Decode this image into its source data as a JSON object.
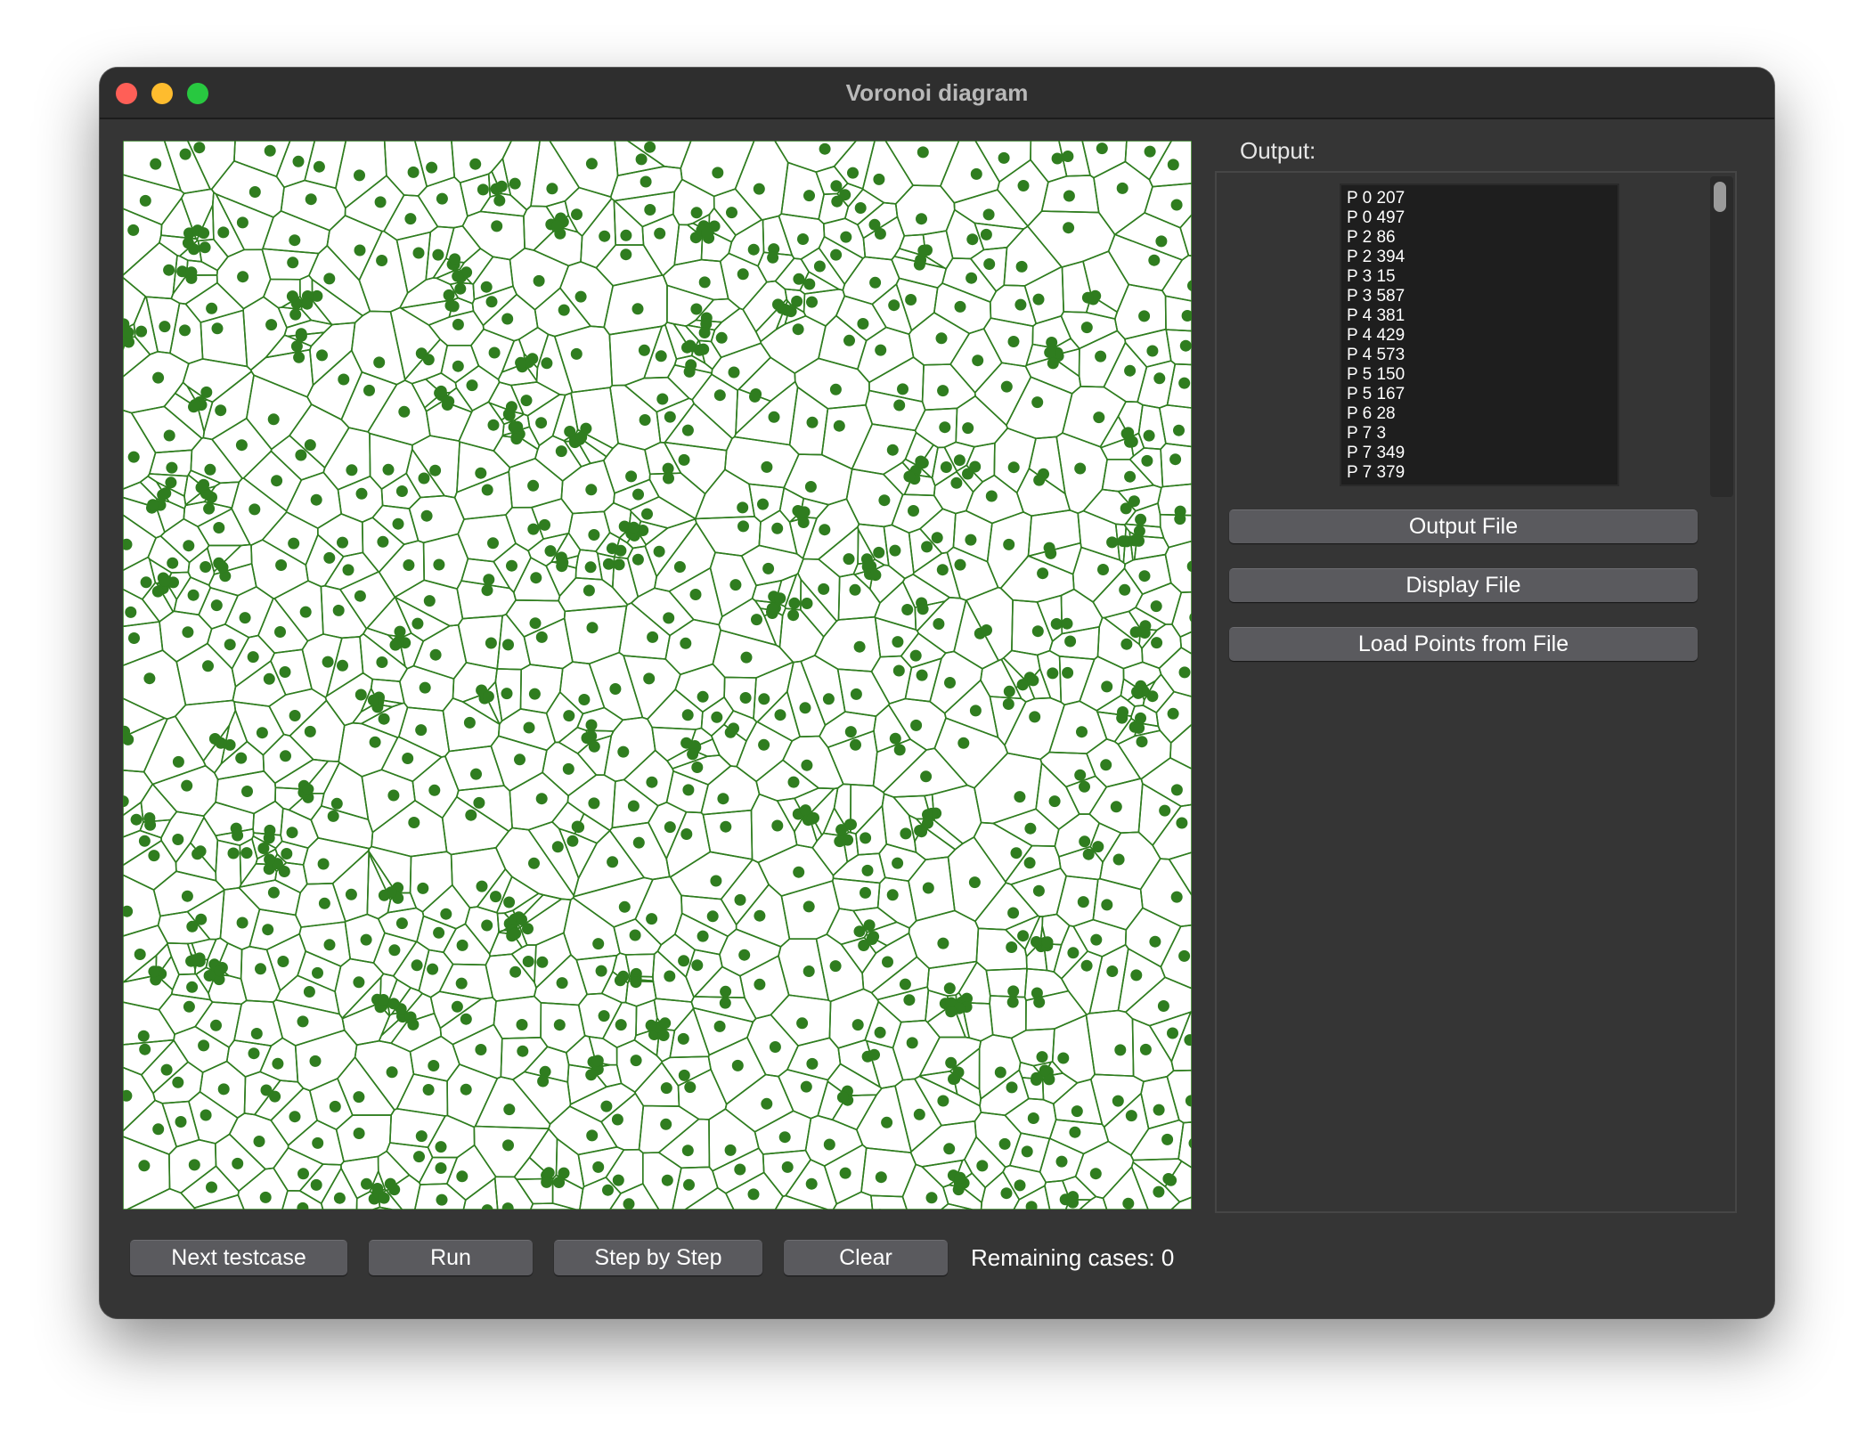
{
  "window": {
    "title": "Voronoi diagram"
  },
  "canvas": {
    "cell_color": "#2f7d1f",
    "point_color": "#2f7d1f",
    "background": "#ffffff"
  },
  "output": {
    "label": "Output:",
    "lines": [
      "P 0 207",
      "P 0 497",
      "P 2 86",
      "P 2 394",
      "P 3 15",
      "P 3 587",
      "P 4 381",
      "P 4 429",
      "P 4 573",
      "P 5 150",
      "P 5 167",
      "P 6 28",
      "P 7 3",
      "P 7 349",
      "P 7 379"
    ]
  },
  "side_buttons": {
    "output_file": "Output File",
    "display_file": "Display File",
    "load_points": "Load Points from File"
  },
  "bottom_bar": {
    "next_testcase": "Next testcase",
    "run": "Run",
    "step_by_step": "Step by Step",
    "clear": "Clear",
    "remaining": "Remaining cases: 0"
  }
}
